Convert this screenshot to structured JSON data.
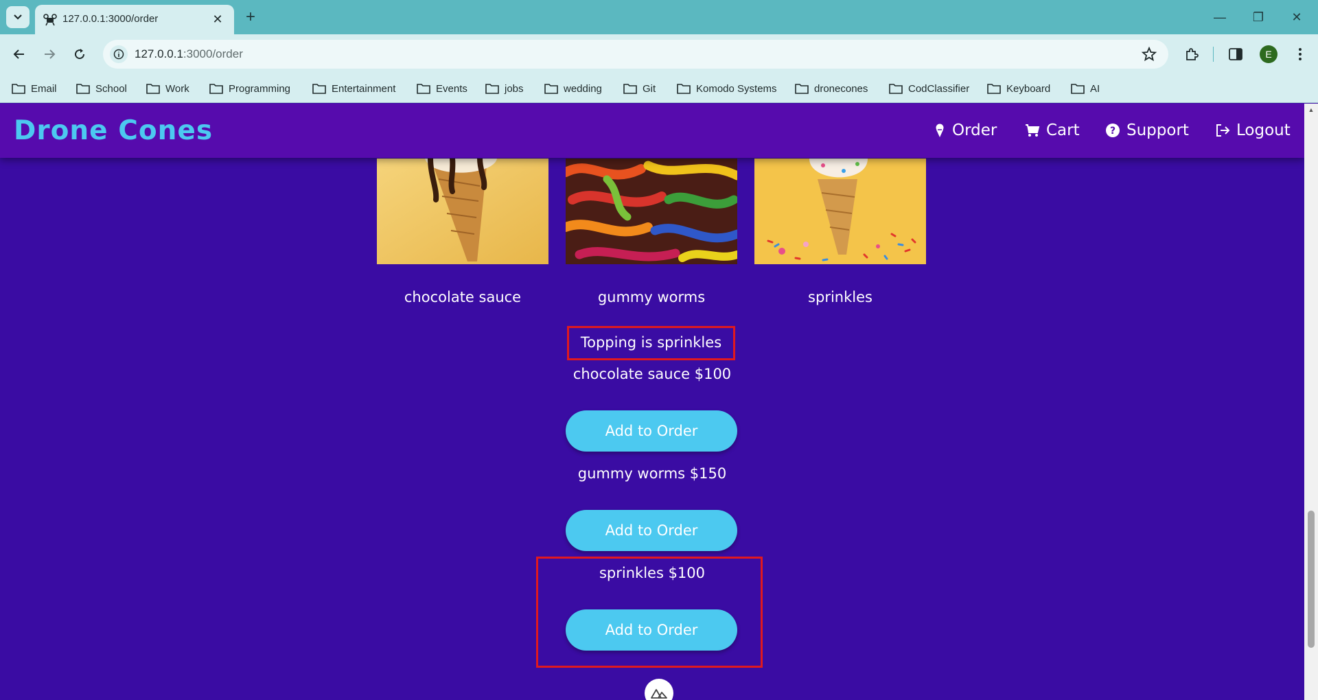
{
  "browser": {
    "tab_title": "127.0.0.1:3000/order",
    "url_host": "127.0.0.1",
    "url_path": ":3000/order",
    "profile_initial": "E",
    "bookmarks": [
      "Email",
      "School",
      "Work",
      "Programming",
      "Entertainment",
      "Events",
      "jobs",
      "wedding",
      "Git",
      "Komodo Systems",
      "dronecones",
      "CodClassifier",
      "Keyboard",
      "AI"
    ]
  },
  "app": {
    "brand": "Drone Cones",
    "nav": {
      "order": "Order",
      "cart": "Cart",
      "support": "Support",
      "logout": "Logout"
    }
  },
  "toppings": [
    {
      "name": "chocolate sauce",
      "image": "chocolate-sauce-cone-image"
    },
    {
      "name": "gummy worms",
      "image": "gummy-worms-image"
    },
    {
      "name": "sprinkles",
      "image": "sprinkles-cone-image"
    }
  ],
  "selected_message": "Topping is sprinkles",
  "price_list": [
    {
      "label": "chocolate sauce $100",
      "button": "Add to Order"
    },
    {
      "label": "gummy worms $150",
      "button": "Add to Order"
    },
    {
      "label": "sprinkles $100",
      "button": "Add to Order"
    }
  ],
  "colors": {
    "page_bg": "#3a0ca3",
    "navbar_bg": "#560bad",
    "accent": "#4cc9f0",
    "highlight": "#e0191f"
  }
}
